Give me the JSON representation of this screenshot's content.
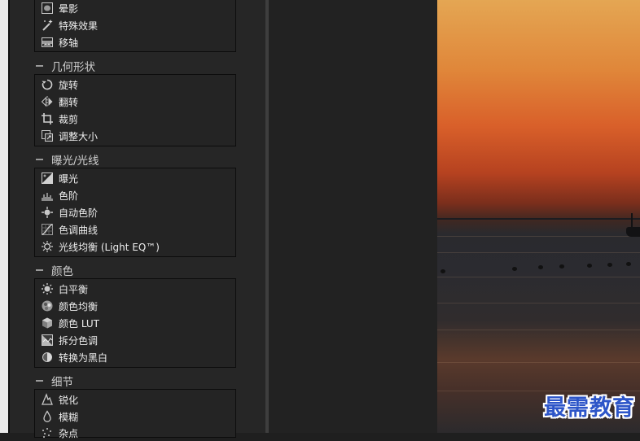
{
  "sections": [
    {
      "title": "",
      "items": [
        {
          "label": "晕影",
          "icon": "vignette-icon"
        },
        {
          "label": "特殊效果",
          "icon": "magic-wand-icon"
        },
        {
          "label": "移轴",
          "icon": "tilt-shift-icon"
        }
      ]
    },
    {
      "title": "几何形状",
      "items": [
        {
          "label": "旋转",
          "icon": "rotate-icon"
        },
        {
          "label": "翻转",
          "icon": "flip-icon"
        },
        {
          "label": "裁剪",
          "icon": "crop-icon"
        },
        {
          "label": "调整大小",
          "icon": "resize-icon"
        }
      ]
    },
    {
      "title": "曝光/光线",
      "items": [
        {
          "label": "曝光",
          "icon": "exposure-icon"
        },
        {
          "label": "色阶",
          "icon": "levels-icon"
        },
        {
          "label": "自动色阶",
          "icon": "auto-levels-icon"
        },
        {
          "label": "色调曲线",
          "icon": "tone-curve-icon"
        },
        {
          "label": "光线均衡 (Light EQ™)",
          "icon": "light-eq-icon"
        }
      ]
    },
    {
      "title": "颜色",
      "items": [
        {
          "label": "白平衡",
          "icon": "white-balance-icon"
        },
        {
          "label": "颜色均衡",
          "icon": "color-balance-icon"
        },
        {
          "label": "颜色 LUT",
          "icon": "color-lut-icon"
        },
        {
          "label": "拆分色调",
          "icon": "split-tone-icon"
        },
        {
          "label": "转换为黑白",
          "icon": "black-white-icon"
        }
      ]
    },
    {
      "title": "细节",
      "items": [
        {
          "label": "锐化",
          "icon": "sharpen-icon"
        },
        {
          "label": "模糊",
          "icon": "blur-icon"
        },
        {
          "label": "杂点",
          "icon": "noise-icon"
        }
      ]
    }
  ],
  "watermark": "最需教育"
}
